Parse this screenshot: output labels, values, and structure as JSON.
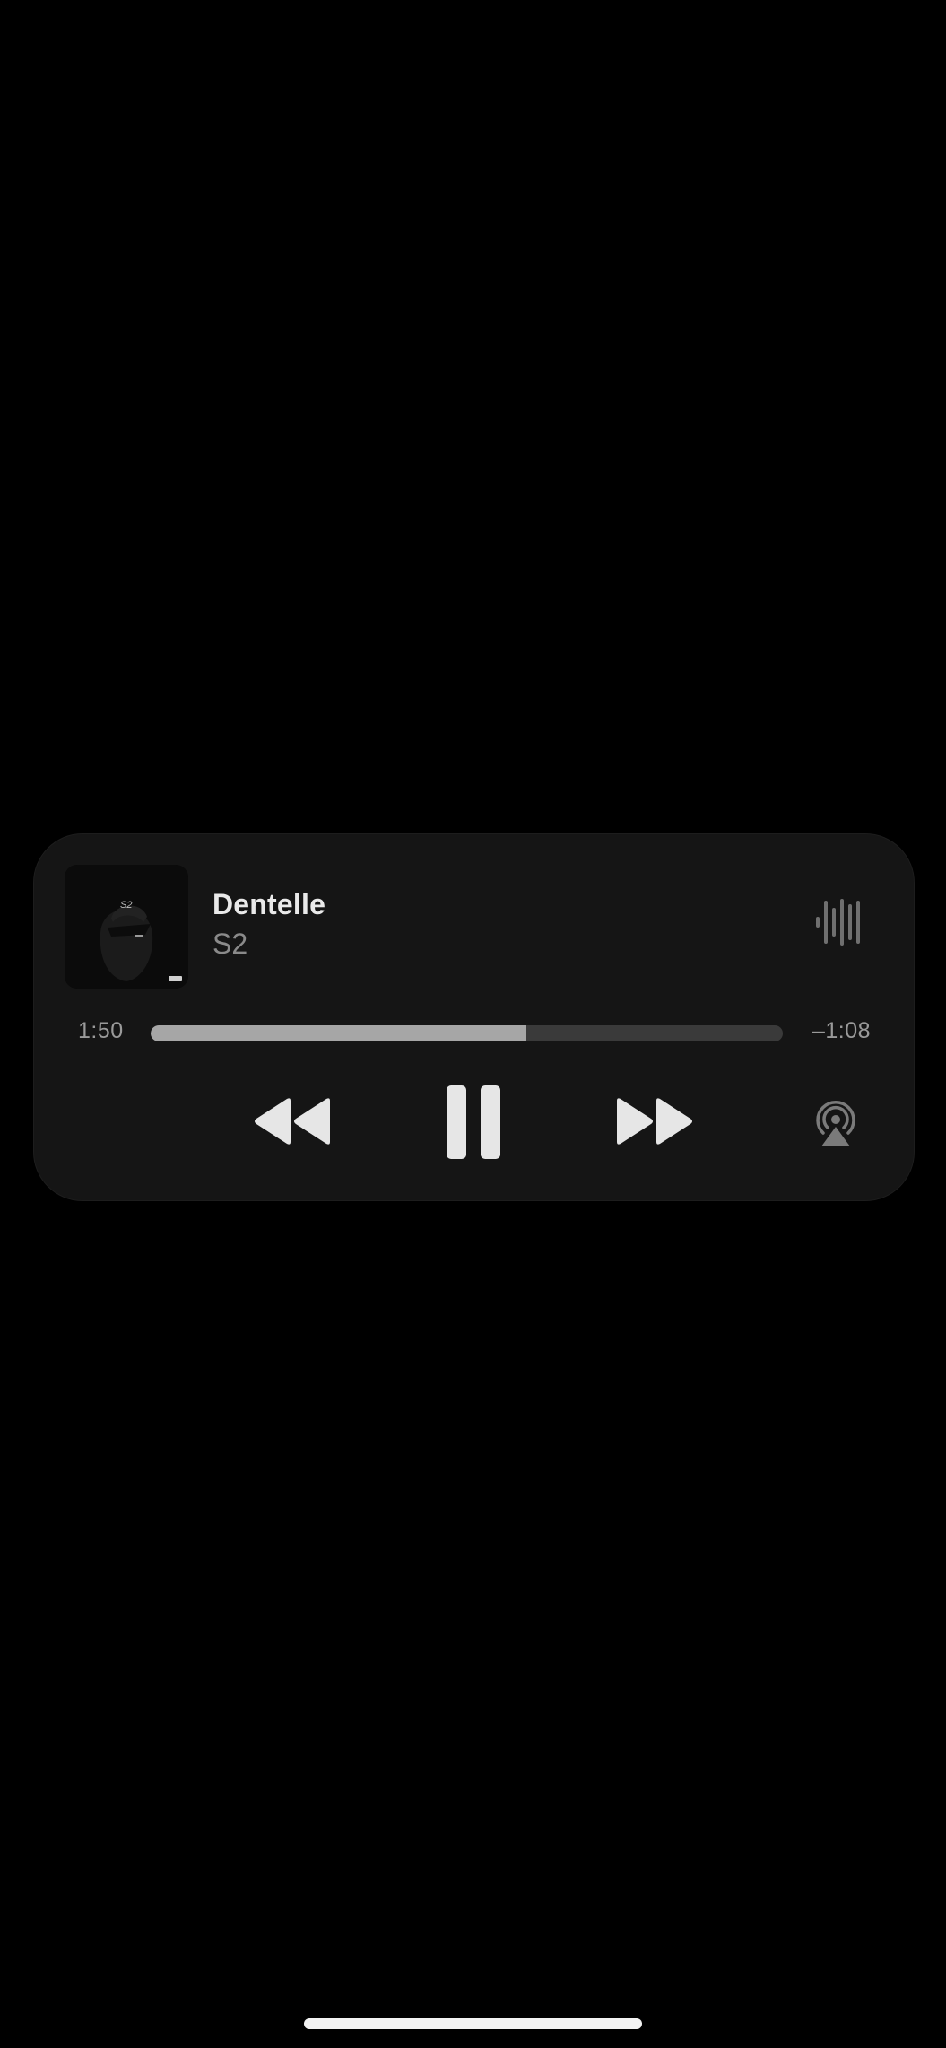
{
  "now_playing": {
    "title": "Dentelle",
    "artist": "S2",
    "artwork_label": "S2",
    "elapsed": "1:50",
    "remaining": "–1:08",
    "progress_fraction": 0.595
  },
  "icons": {
    "waveform": "waveform-icon",
    "rewind": "backward-icon",
    "pause": "pause-icon",
    "forward": "forward-icon",
    "airplay": "airplay-icon"
  },
  "colors": {
    "background": "#000000",
    "card": "#151515",
    "primary_text": "#e9e9e9",
    "secondary_text": "#8a8a8a",
    "progress_fill": "#a6a6a6",
    "progress_track": "#3a3a3a",
    "control": "#e6e6e6"
  }
}
